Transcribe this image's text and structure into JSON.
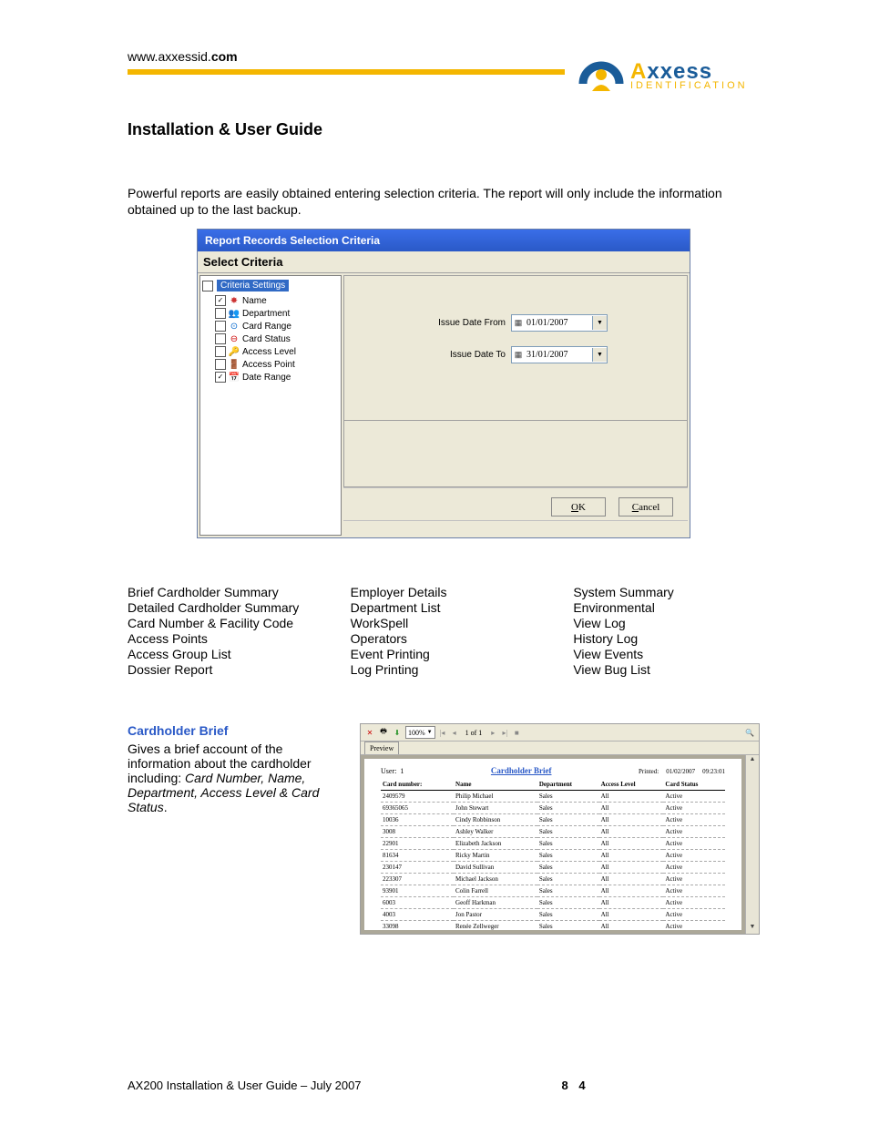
{
  "url_prefix": "www.axxessid.",
  "url_suffix": "com",
  "logo": {
    "brand_first": "A",
    "brand_rest": "xxess",
    "tagline": "Identification"
  },
  "title": "Installation & User Guide",
  "intro": "Powerful reports are easily obtained entering selection criteria. The report will only include the information obtained up to the last backup.",
  "dialog": {
    "titlebar": "Report Records Selection Criteria",
    "select_label": "Select Criteria",
    "root": "Criteria Settings",
    "items": [
      {
        "label": "Name",
        "checked": true
      },
      {
        "label": "Department",
        "checked": false
      },
      {
        "label": "Card Range",
        "checked": false
      },
      {
        "label": "Card Status",
        "checked": false
      },
      {
        "label": "Access Level",
        "checked": false
      },
      {
        "label": "Access Point",
        "checked": false
      },
      {
        "label": "Date Range",
        "checked": true
      }
    ],
    "date_from_label": "Issue Date From",
    "date_from_value": "01/01/2007",
    "date_to_label": "Issue Date To",
    "date_to_value": "31/01/2007",
    "ok": "OK",
    "cancel": "Cancel"
  },
  "report_columns": {
    "col1": [
      "Brief Cardholder Summary",
      "Detailed Cardholder Summary",
      "Card Number & Facility Code",
      "Access Points",
      "Access Group List",
      "Dossier Report"
    ],
    "col2": [
      "Employer Details",
      "Department List",
      "WorkSpell",
      "Operators",
      "Event Printing",
      "Log Printing"
    ],
    "col3": [
      "System Summary",
      "Environmental",
      "View Log",
      "History Log",
      "View Events",
      "View Bug List"
    ]
  },
  "cardholder": {
    "heading": "Cardholder Brief",
    "p1a": "Gives a brief account of the information about the cardholder including: ",
    "p1b": "Card Number, Name, Department, Access Level & Card Status",
    "p1c": "."
  },
  "preview": {
    "zoom": "100%",
    "page_status": "1  of 1",
    "tab": "Preview",
    "user_label": "User:",
    "user_value": "1",
    "title": "Cardholder Brief",
    "printed_label": "Printed:",
    "printed_date": "01/02/2007",
    "printed_time": "09:23:01",
    "columns": [
      "Card number:",
      "Name",
      "Department",
      "Access Level",
      "Card Status"
    ],
    "rows": [
      {
        "c1": "2409579",
        "c2": "Philip  Michael",
        "c3": "Sales",
        "c4": "All",
        "c5": "Active"
      },
      {
        "c1": "69365065",
        "c2": "John  Stewart",
        "c3": "Sales",
        "c4": "All",
        "c5": "Active"
      },
      {
        "c1": "10036",
        "c2": "Cindy  Robbinson",
        "c3": "Sales",
        "c4": "All",
        "c5": "Active"
      },
      {
        "c1": "3008",
        "c2": "Ashley  Walker",
        "c3": "Sales",
        "c4": "All",
        "c5": "Active"
      },
      {
        "c1": "22901",
        "c2": "Elizabeth  Jackson",
        "c3": "Sales",
        "c4": "All",
        "c5": "Active"
      },
      {
        "c1": "81634",
        "c2": "Ricky  Martin",
        "c3": "Sales",
        "c4": "All",
        "c5": "Active"
      },
      {
        "c1": "230147",
        "c2": "David  Sullivan",
        "c3": "Sales",
        "c4": "All",
        "c5": "Active"
      },
      {
        "c1": "223307",
        "c2": "Michael  Jackson",
        "c3": "Sales",
        "c4": "All",
        "c5": "Active"
      },
      {
        "c1": "93901",
        "c2": "Colin  Farrell",
        "c3": "Sales",
        "c4": "All",
        "c5": "Active"
      },
      {
        "c1": "6003",
        "c2": "Geoff  Harkman",
        "c3": "Sales",
        "c4": "All",
        "c5": "Active"
      },
      {
        "c1": "4003",
        "c2": "Jon  Pastor",
        "c3": "Sales",
        "c4": "All",
        "c5": "Active"
      },
      {
        "c1": "33098",
        "c2": "Renée  Zellweger",
        "c3": "Sales",
        "c4": "All",
        "c5": "Active"
      }
    ]
  },
  "footer_text": "AX200 Installation & User Guide – July 2007",
  "page_number": "8 4"
}
